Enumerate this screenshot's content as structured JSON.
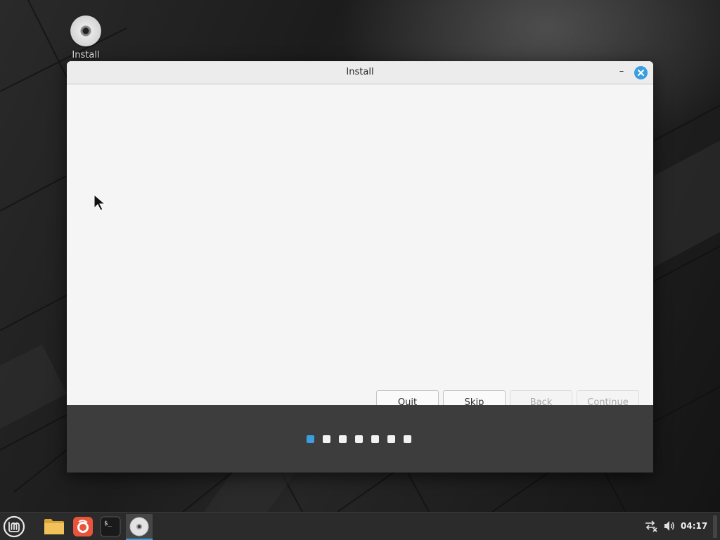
{
  "desktop": {
    "icons": [
      {
        "label": "Install",
        "icon": "disc-icon"
      }
    ]
  },
  "window": {
    "title": "Install",
    "controls": {
      "minimize": "–",
      "close": "close-icon"
    },
    "buttons": {
      "quit": "Quit",
      "skip": "Skip",
      "back": "Back",
      "continue": "Continue"
    },
    "progress": {
      "total_steps": 7,
      "current_step": 1
    }
  },
  "taskbar": {
    "items": [
      "mint-menu-icon",
      "folder-icon",
      "firefox-icon",
      "terminal-icon",
      "installer-disc-icon"
    ],
    "clock": "04:17",
    "tray": [
      "network-disconnected-icon",
      "volume-icon"
    ]
  },
  "colors": {
    "accent": "#3a9ee0",
    "footer": "#3d3d3d",
    "taskbar": "#2b2b2b"
  }
}
